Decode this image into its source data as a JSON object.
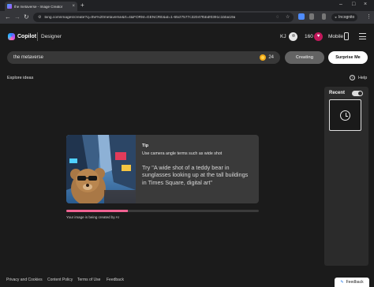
{
  "browser": {
    "tab_title": "the metaverse - Image Creator",
    "url": "bing.com/images/create?q=the%20metaverse&rt=4&FORM=GENCRE&id=1-65cf7577c32047fbbdf0391c1bba19a",
    "incognito_label": "Incognito"
  },
  "header": {
    "brand": "Copilot",
    "product": "Designer",
    "user_initials": "KJ",
    "points": "160",
    "mobile_label": "Mobile"
  },
  "prompt": {
    "text": "the metaverse",
    "boosts": "24",
    "creating_label": "Creating",
    "surprise_label": "Surprise Me"
  },
  "explore_label": "Explore ideas",
  "help_label": "Help",
  "recent": {
    "label": "Recent"
  },
  "tip": {
    "title": "Tip",
    "subtitle": "Use camera angle terms such as wide shot",
    "example": "Try \"A wide shot of a teddy bear in sunglasses looking up at the tall buildings in Times Square, digital art\""
  },
  "progress": {
    "fraction": 0.32,
    "status": "Your image is being created by AI"
  },
  "footer": {
    "links": [
      "Privacy and Cookies",
      "Content Policy",
      "Terms of Use",
      "Feedback"
    ],
    "feedback_button": "Feedback"
  },
  "colors": {
    "accent_progress": "#f06292",
    "background": "#1b1b1b",
    "card": "#3a3a3a"
  },
  "icons": [
    "copilot-logo-icon",
    "avatar-icon",
    "rewards-icon",
    "mobile-icon",
    "menu-icon",
    "coin-icon",
    "help-icon",
    "clock-icon",
    "feedback-icon"
  ]
}
